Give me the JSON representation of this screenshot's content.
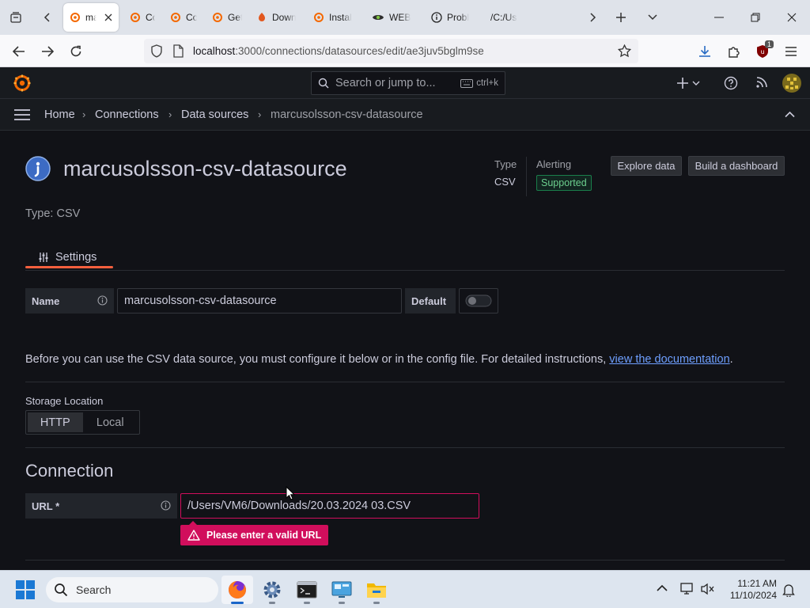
{
  "browser": {
    "tabs": [
      {
        "label": "ma",
        "icon": "grafana-icon",
        "active": true
      },
      {
        "label": "Confi",
        "icon": "grafana-icon"
      },
      {
        "label": "Confi",
        "icon": "grafana-icon"
      },
      {
        "label": "Get si",
        "icon": "grafana-icon"
      },
      {
        "label": "Down",
        "icon": "download-site-icon"
      },
      {
        "label": "Instal",
        "icon": "grafana-icon"
      },
      {
        "label": "WEB",
        "icon": "eye-icon"
      },
      {
        "label": "Probl",
        "icon": "info-icon"
      },
      {
        "label": "/C:/Use",
        "icon": "none"
      }
    ],
    "url_host": "localhost",
    "url_rest": ":3000/connections/datasources/edit/ae3juv5bglm9se",
    "extension_badge": "1"
  },
  "grafana": {
    "search_placeholder": "Search or jump to...",
    "search_shortcut": "ctrl+k",
    "breadcrumb": [
      "Home",
      "Connections",
      "Data sources",
      "marcusolsson-csv-datasource"
    ],
    "datasource_title": "marcusolsson-csv-datasource",
    "type_subtitle": "Type: CSV",
    "meta": {
      "type_label": "Type",
      "type_value": "CSV",
      "alerting_label": "Alerting",
      "alerting_value": "Supported"
    },
    "buttons": {
      "explore": "Explore data",
      "build": "Build a dashboard"
    },
    "tab_settings": "Settings",
    "name_label": "Name",
    "name_value": "marcusolsson-csv-datasource",
    "default_label": "Default",
    "help_text": "Before you can use the CSV data source, you must configure it below or in the config file. For detailed instructions, ",
    "help_link": "view the documentation",
    "help_end": ".",
    "storage_label": "Storage Location",
    "storage_options": [
      "HTTP",
      "Local"
    ],
    "storage_selected": "HTTP",
    "connection_heading": "Connection",
    "url_label": "URL *",
    "url_value": "/Users/VM6/Downloads/20.03.2024 03.CSV",
    "url_error": "Please enter a valid URL"
  },
  "taskbar": {
    "search_label": "Search",
    "time": "11:21 AM",
    "date": "11/10/2024"
  },
  "colors": {
    "grafana_orange": "#f55f3e",
    "error_pink": "#d10e5c",
    "success_green": "#1a7f4b",
    "link_blue": "#6e9fff"
  }
}
